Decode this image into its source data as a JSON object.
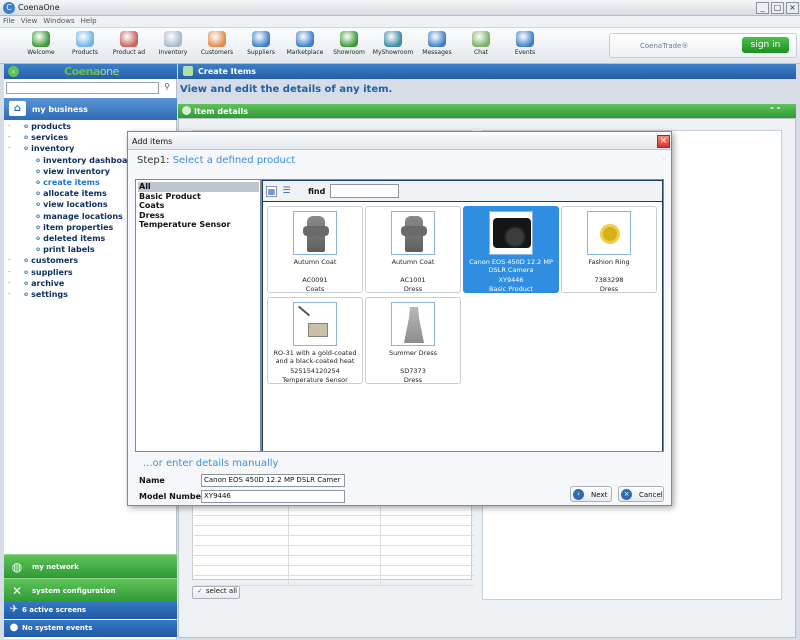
{
  "window": {
    "title": "CoenaOne"
  },
  "menu": [
    "File",
    "View",
    "Windows",
    "Help"
  ],
  "toolbar": {
    "items": [
      {
        "label": "Welcome",
        "icon": "welcome-icon",
        "color": "#3a9a3a"
      },
      {
        "label": "Products",
        "icon": "products-icon",
        "color": "#6fb3e8"
      },
      {
        "label": "Product ad",
        "icon": "product-ad-icon",
        "color": "#c86060"
      },
      {
        "label": "Inventory",
        "icon": "inventory-icon",
        "color": "#a8b8c8"
      },
      {
        "label": "Customers",
        "icon": "customers-icon",
        "color": "#e08a4a"
      },
      {
        "label": "Suppliers",
        "icon": "suppliers-icon",
        "color": "#3d80c8"
      },
      {
        "label": "Marketplace",
        "icon": "marketplace-icon",
        "color": "#3d80c8"
      },
      {
        "label": "Showroom",
        "icon": "showroom-icon",
        "color": "#3a9a3a"
      },
      {
        "label": "MyShowroom",
        "icon": "myshowroom-icon",
        "color": "#3a8aa8"
      },
      {
        "label": "Messages",
        "icon": "messages-icon",
        "color": "#3d80c8"
      },
      {
        "label": "Chat",
        "icon": "chat-icon",
        "color": "#7ab06a"
      },
      {
        "label": "Events",
        "icon": "events-icon",
        "color": "#3d80c8"
      }
    ],
    "trade_label": "CoenaTrade®",
    "signin_label": "sign in"
  },
  "sidebar": {
    "logo": {
      "brand": "Coena",
      "suffix": "one"
    },
    "search_placeholder": "",
    "section_title": "my business",
    "items": [
      {
        "label": "products",
        "level": 1
      },
      {
        "label": "services",
        "level": 1
      },
      {
        "label": "inventory",
        "level": 1
      },
      {
        "label": "inventory dashboard",
        "level": 2
      },
      {
        "label": "view inventory",
        "level": 2
      },
      {
        "label": "create items",
        "level": 2,
        "active": true
      },
      {
        "label": "allocate items",
        "level": 2
      },
      {
        "label": "view locations",
        "level": 2
      },
      {
        "label": "manage locations",
        "level": 2
      },
      {
        "label": "item properties",
        "level": 2
      },
      {
        "label": "deleted items",
        "level": 2
      },
      {
        "label": "print labels",
        "level": 2
      },
      {
        "label": "customers",
        "level": 1
      },
      {
        "label": "suppliers",
        "level": 1
      },
      {
        "label": "archive",
        "level": 1
      },
      {
        "label": "settings",
        "level": 1
      }
    ],
    "network_label": "my network",
    "sysconfig_label": "system configuration",
    "active_screens_label": "6 active screens",
    "system_events_label": "No system events"
  },
  "main": {
    "header": "Create Items",
    "subtitle": "View and edit the details of any item.",
    "details_title": "Item details",
    "select_all_label": "select all"
  },
  "dialog": {
    "title": "Add items",
    "step_prefix": "Step1:",
    "step_text": "Select a defined product",
    "categories": [
      "All",
      "Basic Product",
      "Coats",
      "Dress",
      "Temperature Sensor"
    ],
    "selected_category": "All",
    "find_label": "find",
    "find_value": "",
    "products": [
      {
        "name": "Autumn Coat",
        "code": "AC0091",
        "category": "Coats",
        "image": "coat",
        "selected": false
      },
      {
        "name": "Autumn Coat",
        "code": "AC1001",
        "category": "Dress",
        "image": "coat",
        "selected": false
      },
      {
        "name": "Canon EOS 450D 12.2 MP DSLR Camera",
        "code": "XY9446",
        "category": "Basic Product",
        "image": "camera",
        "selected": true
      },
      {
        "name": "Fashion Ring",
        "code": "7383298",
        "category": "Dress",
        "image": "ring",
        "selected": false
      },
      {
        "name": "RO-31 with a gold-coated and a black-coated heat",
        "code": "525154120254",
        "category": "Temperature Sensor",
        "image": "sensor",
        "selected": false
      },
      {
        "name": "Summer Dress",
        "code": "SD7373",
        "category": "Dress",
        "image": "dress",
        "selected": false
      }
    ],
    "manual_label": "...or enter details manually",
    "name_label": "Name",
    "name_value": "Canon EOS 450D 12.2 MP DSLR Camer",
    "model_label": "Model Number",
    "model_value": "XY9446",
    "next_label": "Next",
    "cancel_label": "Cancel"
  }
}
